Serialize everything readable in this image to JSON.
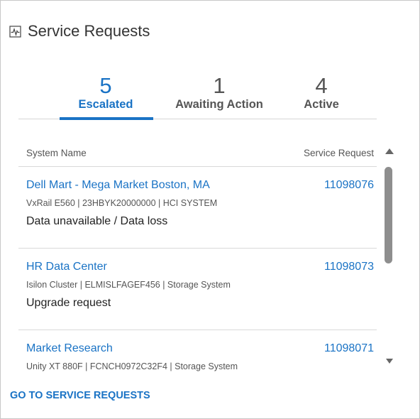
{
  "header": {
    "title": "Service Requests",
    "icon": "activity-chart-icon"
  },
  "tabs": [
    {
      "count": "5",
      "label": "Escalated",
      "selected": true
    },
    {
      "count": "1",
      "label": "Awaiting Action",
      "selected": false
    },
    {
      "count": "4",
      "label": "Active",
      "selected": false
    }
  ],
  "table": {
    "columns": {
      "system_name": "System Name",
      "service_request": "Service Request"
    },
    "rows": [
      {
        "system_name": "Dell Mart - Mega Market Boston, MA",
        "service_request": "11098076",
        "detail": "VxRail E560 | 23HBYK20000000 | HCI SYSTEM",
        "issue": "Data unavailable / Data loss"
      },
      {
        "system_name": "HR Data Center",
        "service_request": "11098073",
        "detail": "Isilon Cluster | ELMISLFAGEF456 | Storage System",
        "issue": "Upgrade request"
      },
      {
        "system_name": "Market Research",
        "service_request": "11098071",
        "detail": "Unity XT 880F | FCNCH0972C32F4 | Storage System",
        "issue": ""
      }
    ]
  },
  "footer": {
    "link_label": "GO TO SERVICE REQUESTS"
  },
  "colors": {
    "accent": "#1a73c5",
    "text": "#222222",
    "muted": "#555555",
    "divider": "#d9d9d9"
  }
}
